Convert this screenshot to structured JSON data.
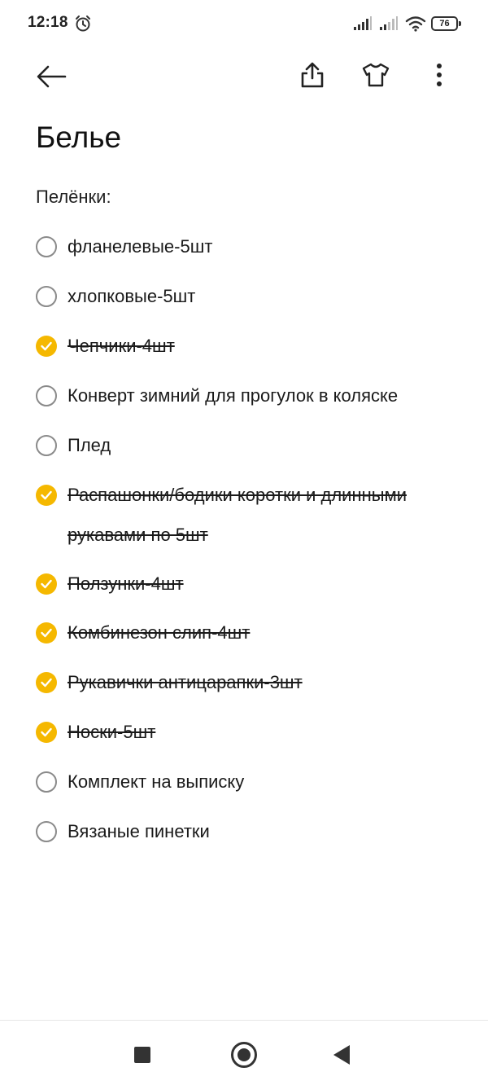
{
  "status_bar": {
    "time": "12:18",
    "battery": "76",
    "icons": [
      "alarm-icon",
      "signal-icon",
      "signal-icon",
      "wifi-icon",
      "battery-icon"
    ]
  },
  "app_bar": {
    "icons": [
      "arrow-left-icon",
      "share-icon",
      "shirt-icon",
      "more-vertical-icon"
    ]
  },
  "note": {
    "title": "Белье",
    "section_label": "Пелёнки:",
    "items": [
      {
        "text": "фланелевые-5шт",
        "checked": false
      },
      {
        "text": "хлопковые-5шт",
        "checked": false
      },
      {
        "text": "Чепчики-4шт",
        "checked": true
      },
      {
        "text": "Конверт зимний для прогулок в коляске",
        "checked": false
      },
      {
        "text": "Плед",
        "checked": false
      },
      {
        "text": "Распашонки/бодики коротки и длинными рукавами по 5шт",
        "checked": true
      },
      {
        "text": "Ползунки-4шт",
        "checked": true
      },
      {
        "text": "Комбинезон слип-4шт",
        "checked": true
      },
      {
        "text": "Рукавички антицарапки-3шт",
        "checked": true
      },
      {
        "text": "Носки-5шт",
        "checked": true
      },
      {
        "text": "Комплект на выписку",
        "checked": false
      },
      {
        "text": "Вязаные пинетки",
        "checked": false
      }
    ]
  },
  "colors": {
    "accent": "#f5b800",
    "text": "#1a1a1a",
    "unchecked_border": "#8a8a8a"
  },
  "nav_bar": {
    "icons": [
      "recents-square-icon",
      "home-circle-icon",
      "back-triangle-icon"
    ]
  }
}
